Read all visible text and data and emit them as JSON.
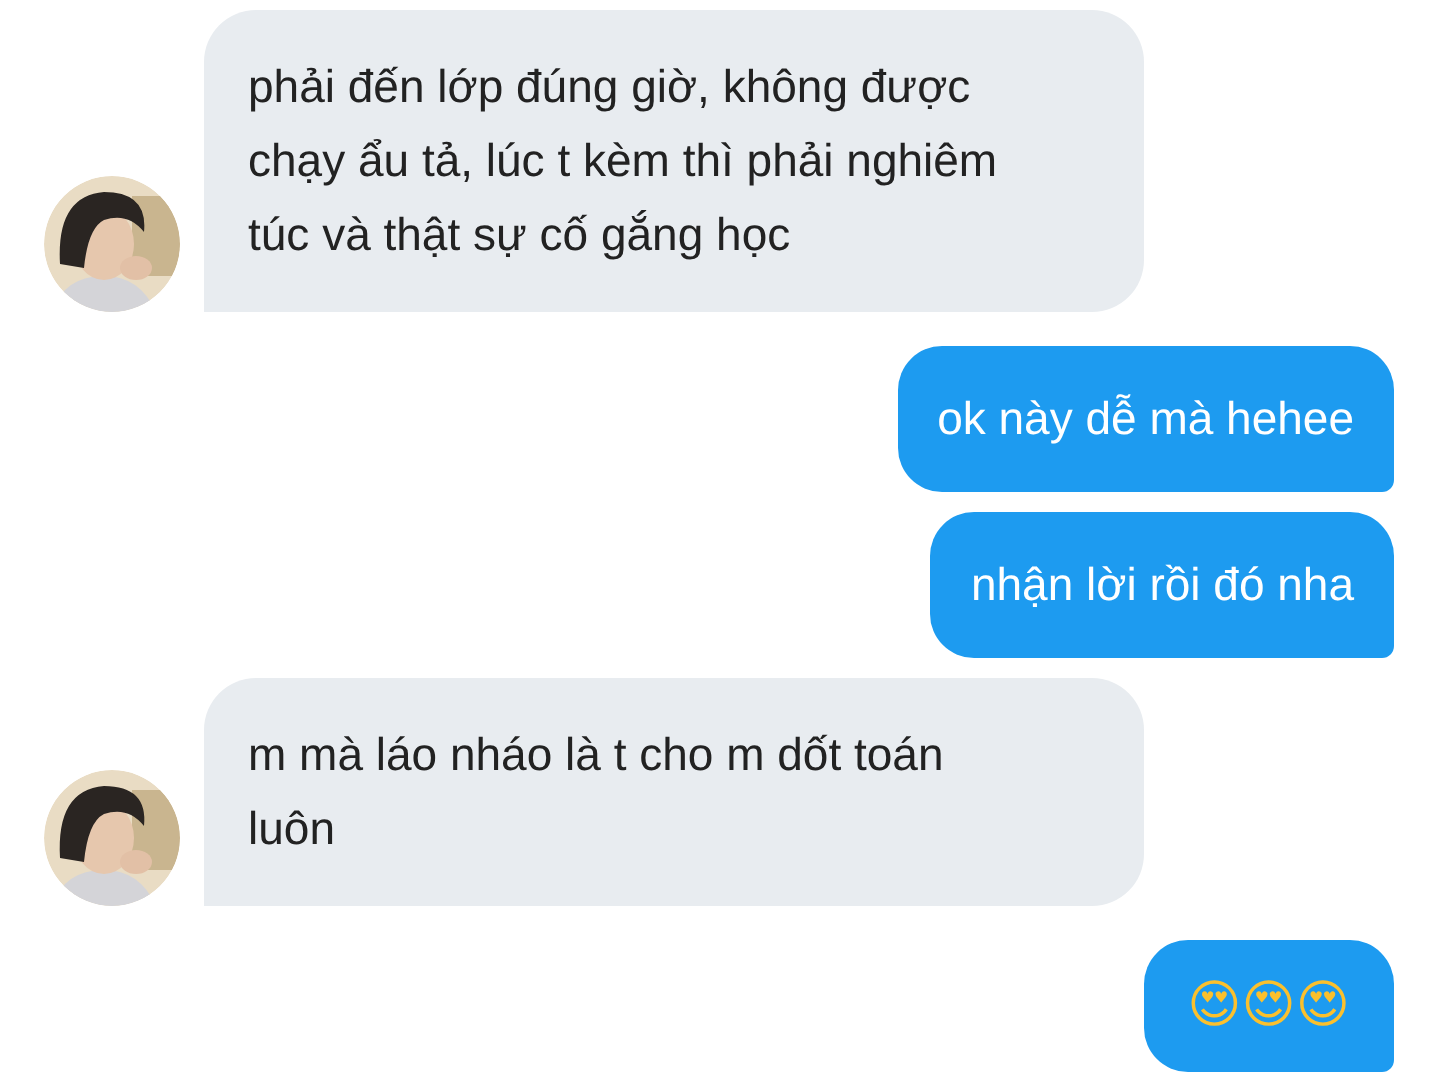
{
  "messages": [
    {
      "kind": "received",
      "text": "phải đến lớp đúng giờ, không được chạy ẩu tả, lúc t kèm thì phải nghiêm túc và thật sự cố gắng học"
    },
    {
      "kind": "sent",
      "text": "ok này dễ mà hehee"
    },
    {
      "kind": "sent",
      "text": "nhận lời rồi đó nha"
    },
    {
      "kind": "received",
      "text": "m mà láo nháo là t cho m dốt toán luôn"
    },
    {
      "kind": "emoji",
      "text": "😍😍😍"
    }
  ]
}
